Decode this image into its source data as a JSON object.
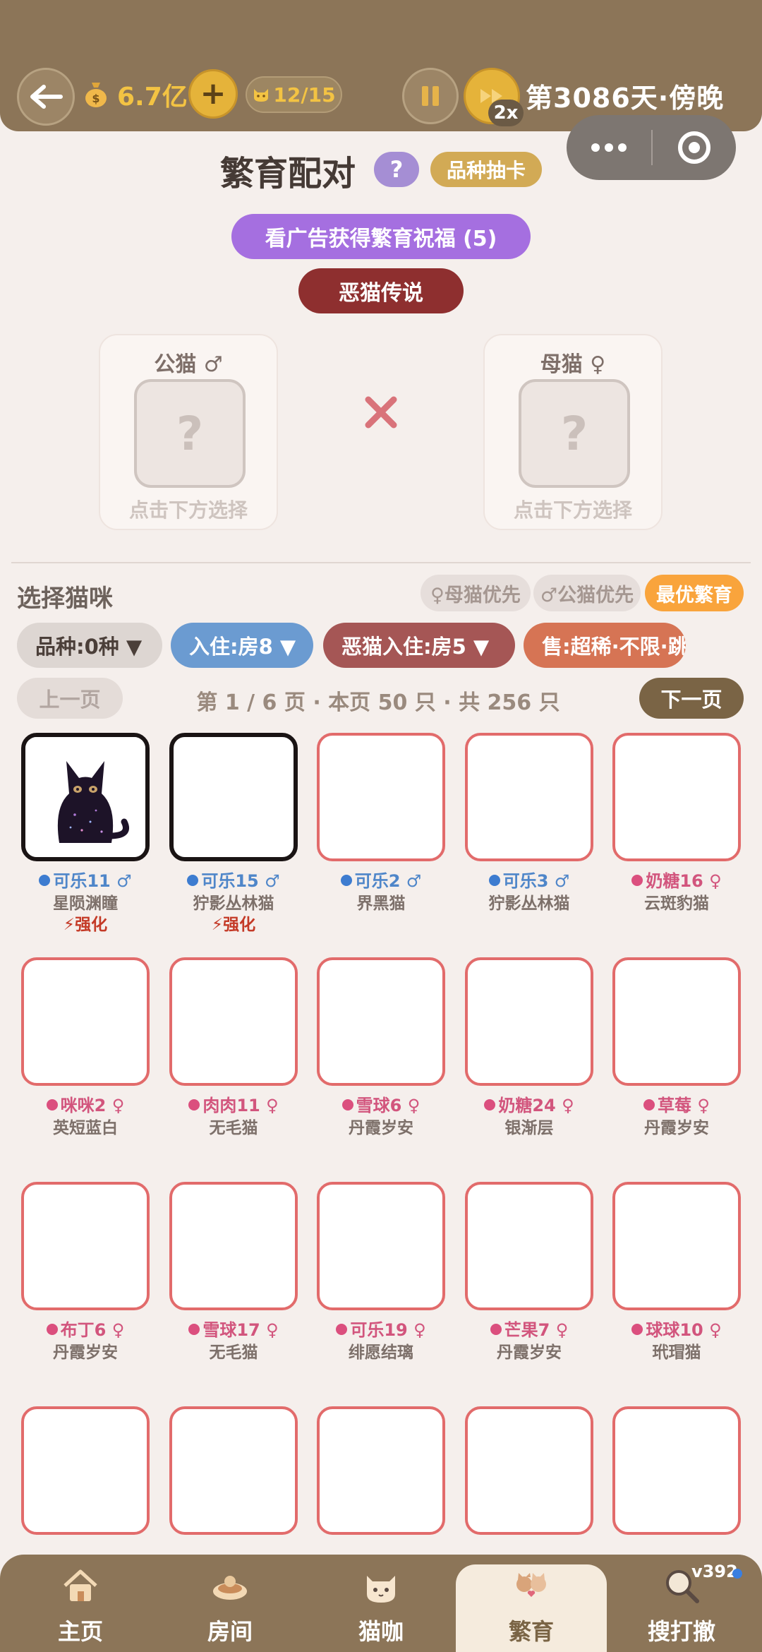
{
  "header": {
    "money": "6.7亿",
    "plus_label": "+",
    "cat_count": "12/15",
    "speed_badge": "2x",
    "day": "第3086天·傍晚"
  },
  "title": {
    "text": "繁育配对",
    "help_label": "?",
    "gacha_label": "品种抽卡"
  },
  "actions": {
    "ad_blessing": "看广告获得繁育祝福 (5)",
    "evil_legend": "恶猫传说"
  },
  "pair": {
    "male_label": "公猫 ♂",
    "female_label": "母猫 ♀",
    "placeholder": "?",
    "hint": "点击下方选择"
  },
  "select": {
    "title": "选择猫咪",
    "chips": [
      "♀母猫优先",
      "♂公猫优先",
      "最优繁育"
    ],
    "filters": [
      "品种:0种 ▼",
      "入住:房8 ▼",
      "恶猫入住:房5 ▼",
      "售:超稀·不限·跳"
    ],
    "prev": "上一页",
    "next": "下一页",
    "page_info": "第 1 / 6 页 · 本页 50 只 · 共 256 只"
  },
  "cats": [
    {
      "name": "可乐11 ♂",
      "breed": "星陨渊瞳",
      "sex": "male",
      "tag": "⚡强化",
      "selected": true,
      "image": "black-cat-photo"
    },
    {
      "name": "可乐15 ♂",
      "breed": "狞影丛林猫",
      "sex": "male",
      "tag": "⚡强化",
      "selected": true
    },
    {
      "name": "可乐2 ♂",
      "breed": "界黑猫",
      "sex": "male",
      "tag": ""
    },
    {
      "name": "可乐3 ♂",
      "breed": "狞影丛林猫",
      "sex": "male",
      "tag": ""
    },
    {
      "name": "奶糖16 ♀",
      "breed": "云斑豹猫",
      "sex": "female",
      "tag": ""
    },
    {
      "name": "咪咪2 ♀",
      "breed": "英短蓝白",
      "sex": "female",
      "tag": ""
    },
    {
      "name": "肉肉11 ♀",
      "breed": "无毛猫",
      "sex": "female",
      "tag": ""
    },
    {
      "name": "雪球6 ♀",
      "breed": "丹霞岁安",
      "sex": "female",
      "tag": ""
    },
    {
      "name": "奶糖24 ♀",
      "breed": "银渐层",
      "sex": "female",
      "tag": ""
    },
    {
      "name": "草莓 ♀",
      "breed": "丹霞岁安",
      "sex": "female",
      "tag": ""
    },
    {
      "name": "布丁6 ♀",
      "breed": "丹霞岁安",
      "sex": "female",
      "tag": ""
    },
    {
      "name": "雪球17 ♀",
      "breed": "无毛猫",
      "sex": "female",
      "tag": ""
    },
    {
      "name": "可乐19 ♀",
      "breed": "绯愿结璃",
      "sex": "female",
      "tag": ""
    },
    {
      "name": "芒果7 ♀",
      "breed": "丹霞岁安",
      "sex": "female",
      "tag": ""
    },
    {
      "name": "球球10 ♀",
      "breed": "玳瑁猫",
      "sex": "female",
      "tag": ""
    }
  ],
  "nav": {
    "tabs": [
      "主页",
      "房间",
      "猫咖",
      "繁育",
      "搜打撤"
    ],
    "active": "繁育",
    "version": "v392"
  },
  "colors": {
    "header_bg": "#8c7558",
    "accent_gold": "#e5b33a",
    "purple": "#a56fe0",
    "dark_red": "#8e2f2f",
    "card_border": "#e26b6b",
    "male": "#3d7cd0",
    "female": "#db4f7e"
  }
}
